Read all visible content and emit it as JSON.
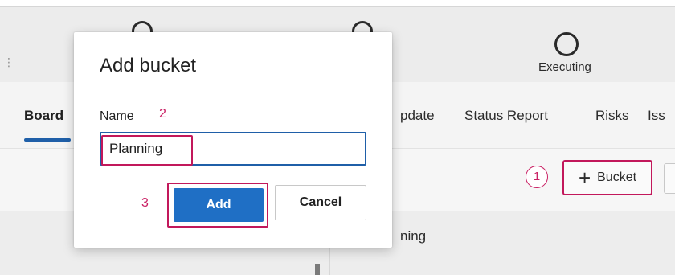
{
  "stages": {
    "executing_label": "Executing"
  },
  "tabs": {
    "board": "Board",
    "update_partial": "pdate",
    "status_report": "Status Report",
    "risks": "Risks",
    "issues_partial": "Iss"
  },
  "toolbar": {
    "bucket_icon": "plus-icon",
    "bucket_label": "Bucket"
  },
  "column": {
    "partial_title": "ning"
  },
  "dialog": {
    "title": "Add bucket",
    "name_label": "Name",
    "name_value": "Planning",
    "add_label": "Add",
    "cancel_label": "Cancel"
  },
  "callouts": {
    "step1": "1",
    "step2": "2",
    "step3": "3"
  },
  "colors": {
    "accent": "#1f6fc5",
    "highlight": "#c2185b"
  }
}
